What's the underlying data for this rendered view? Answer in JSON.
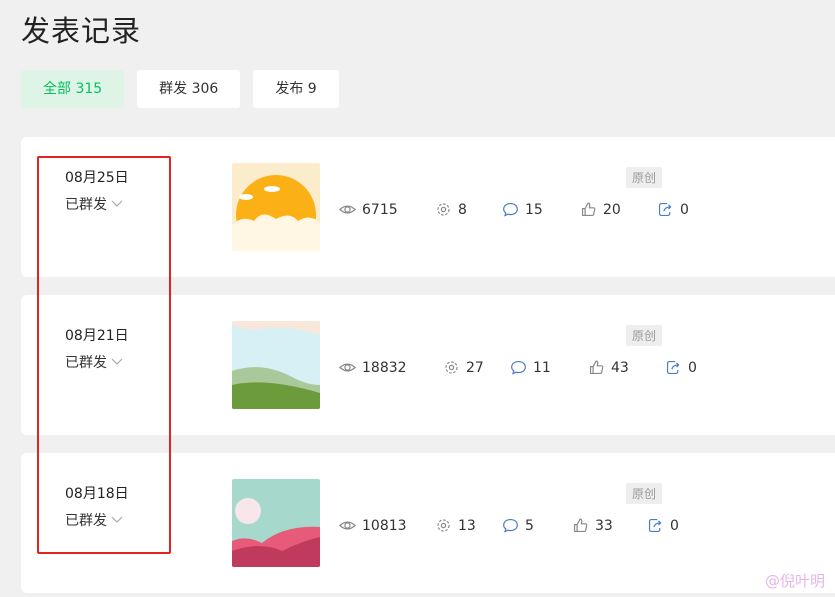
{
  "page_title": "发表记录",
  "tabs": [
    {
      "label": "全部 315",
      "active": true
    },
    {
      "label": "群发 306",
      "active": false
    },
    {
      "label": "发布 9",
      "active": false
    }
  ],
  "records": [
    {
      "date": "08月25日",
      "status": "已群发",
      "badge": "原创",
      "views": "6715",
      "shares": "8",
      "comments": "15",
      "likes": "20",
      "forwards": "0"
    },
    {
      "date": "08月21日",
      "status": "已群发",
      "badge": "原创",
      "views": "18832",
      "shares": "27",
      "comments": "11",
      "likes": "43",
      "forwards": "0"
    },
    {
      "date": "08月18日",
      "status": "已群发",
      "badge": "原创",
      "views": "10813",
      "shares": "13",
      "comments": "5",
      "likes": "33",
      "forwards": "0"
    }
  ],
  "watermark": "@倪叶明",
  "colors": {
    "accent_green": "#07c160",
    "annotation_red": "#e3231d"
  }
}
